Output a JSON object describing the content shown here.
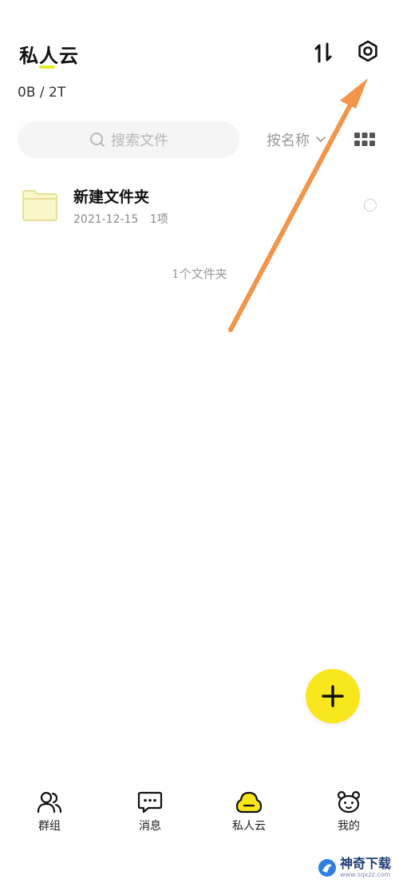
{
  "header": {
    "title": "私人云",
    "storage": "0B / 2T"
  },
  "toolbar": {
    "search_placeholder": "搜索文件",
    "sort_label": "按名称"
  },
  "files": [
    {
      "name": "新建文件夹",
      "date": "2021-12-15",
      "count": "1项"
    }
  ],
  "summary": "1个文件夹",
  "nav": [
    {
      "label": "群组",
      "icon": "group-icon"
    },
    {
      "label": "消息",
      "icon": "message-icon"
    },
    {
      "label": "私人云",
      "icon": "cloud-icon"
    },
    {
      "label": "我的",
      "icon": "bear-icon"
    }
  ],
  "watermark": {
    "main": "神奇下载",
    "sub": "www.sqxzz.com"
  },
  "colors": {
    "accent": "#f8e71c",
    "folder": "#f9f6c8",
    "folder_border": "#e6e196",
    "annotation_arrow": "#f2944a"
  }
}
